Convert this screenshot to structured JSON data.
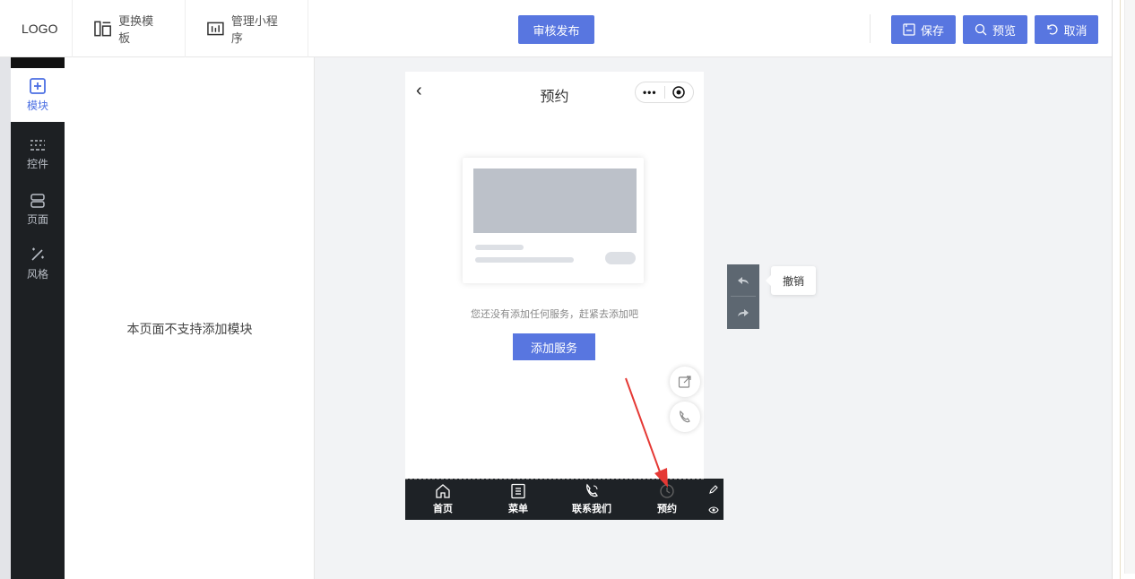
{
  "header": {
    "logo": "LOGO",
    "change_template": "更换模板",
    "manage_miniprogram": "管理小程序",
    "publish": "审核发布",
    "save": "保存",
    "preview": "预览",
    "cancel": "取消"
  },
  "sidebar": {
    "items": [
      {
        "label": "模块",
        "icon": "plus-square-icon",
        "active": true
      },
      {
        "label": "控件",
        "icon": "sliders-icon",
        "active": false
      },
      {
        "label": "页面",
        "icon": "page-stack-icon",
        "active": false
      },
      {
        "label": "风格",
        "icon": "magic-wand-icon",
        "active": false
      }
    ]
  },
  "panel": {
    "message": "本页面不支持添加模块"
  },
  "phone": {
    "title": "预约",
    "capsule_dots": "•••",
    "empty_text": "您还没有添加任何服务，赶紧去添加吧",
    "add_button": "添加服务"
  },
  "tabbar": {
    "items": [
      {
        "label": "首页",
        "icon": "home-icon"
      },
      {
        "label": "菜单",
        "icon": "menu-doc-icon"
      },
      {
        "label": "联系我们",
        "icon": "phone-icon"
      },
      {
        "label": "预约",
        "icon": "clock-icon"
      }
    ]
  },
  "undo_tooltip": "撤销",
  "colors": {
    "accent": "#5876e0",
    "sidebar_bg": "#1d2023",
    "arrow": "#e53935"
  }
}
